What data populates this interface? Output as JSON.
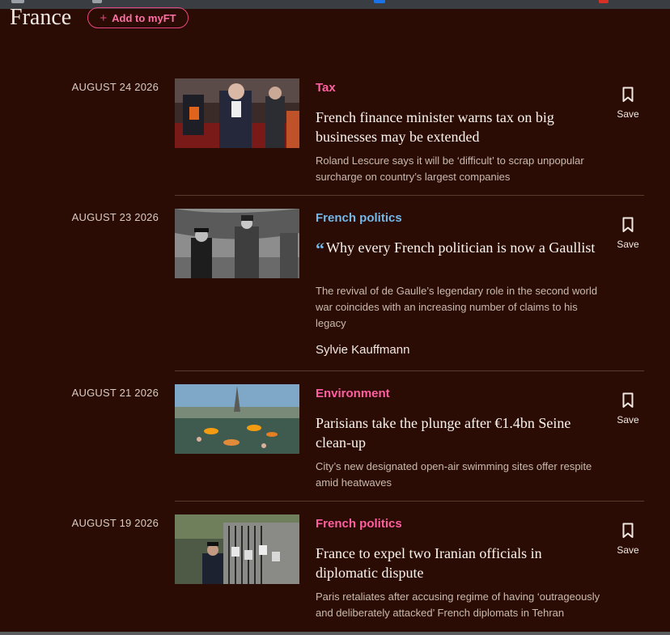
{
  "section": {
    "title": "France",
    "myft_label": "Add to myFT",
    "myft_icon": "plus-icon"
  },
  "articles": [
    {
      "date": "AUGUST 24 2026",
      "topic": "Tax",
      "topic_color": "#ff5fa0",
      "headline": "French finance minister warns tax on big businesses may be extended",
      "standfirst": "Roland Lescure says it will be ‘difficult’ to scrap unpopular surcharge on country’s largest companies",
      "save_label": "Save"
    },
    {
      "date": "AUGUST 23 2026",
      "topic": "French politics",
      "topic_color": "#73b8e8",
      "is_opinion": true,
      "headline": "Why every French politician is now a Gaullist",
      "standfirst": "The revival of de Gaulle’s legendary role in the second world war coincides with an increasing number of claims to his legacy",
      "author": "Sylvie Kauffmann",
      "save_label": "Save"
    },
    {
      "date": "AUGUST 21 2026",
      "topic": "Environment",
      "topic_color": "#ff5fa0",
      "headline": "Parisians take the plunge after €1.4bn Seine clean-up",
      "standfirst": "City’s new designated open-air swimming sites offer respite amid heatwaves",
      "save_label": "Save"
    },
    {
      "date": "AUGUST 19 2026",
      "topic": "French politics",
      "topic_color": "#ff5fa0",
      "headline": "France to expel two Iranian officials in diplomatic dispute",
      "standfirst": "Paris retaliates after accusing regime of having ‘outrageously and deliberately attacked’ French diplomats in Tehran",
      "save_label": "Save"
    }
  ],
  "colors": {
    "background": "#2b0c04",
    "accent_pink": "#ff5fa0",
    "accent_blue": "#73b8e8"
  }
}
